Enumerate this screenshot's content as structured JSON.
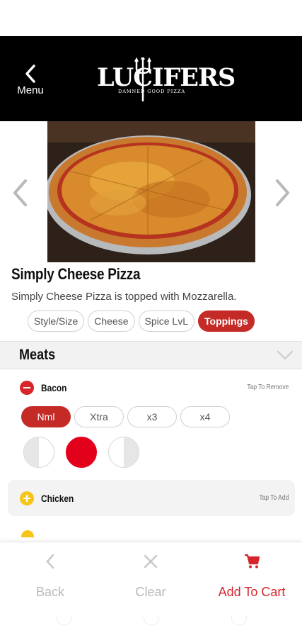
{
  "header": {
    "back_label": "Menu",
    "logo_text": "LUCIFERS",
    "logo_tagline": "DAMNED GOOD PIZZA"
  },
  "product": {
    "name": "Simply Cheese Pizza",
    "description": "Simply Cheese Pizza is topped with Mozzarella."
  },
  "tabs": [
    {
      "label": "Style/Size",
      "active": false
    },
    {
      "label": "Cheese",
      "active": false
    },
    {
      "label": "Spice LvL",
      "active": false
    },
    {
      "label": "Toppings",
      "active": true
    }
  ],
  "section": {
    "title": "Meats"
  },
  "items": [
    {
      "name": "Bacon",
      "hint": "Tap To Remove",
      "selected": true
    },
    {
      "name": "Chicken",
      "hint": "Tap To Add",
      "selected": false
    }
  ],
  "quantity_options": [
    {
      "label": "Nml",
      "active": true
    },
    {
      "label": "Xtra",
      "active": false
    },
    {
      "label": "x3",
      "active": false
    },
    {
      "label": "x4",
      "active": false
    }
  ],
  "placement_options": [
    "left-half",
    "whole",
    "right-half"
  ],
  "placement_selected": "whole",
  "footer": {
    "back_label": "Back",
    "clear_label": "Clear",
    "cart_label": "Add To Cart"
  },
  "colors": {
    "accent": "#c42b27",
    "remove_dot": "#d7262b",
    "add_dot": "#f5c518",
    "header_bg": "#000000"
  }
}
